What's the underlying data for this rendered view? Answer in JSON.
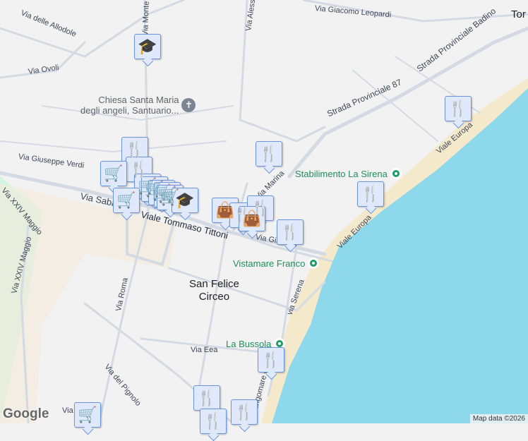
{
  "streets": [
    "Via delle Allodole",
    "Via Ovoli",
    "Via Giuseppe Verdi",
    "Via XXIV Maggio",
    "Via XXIV Maggio",
    "Via Sabaudia",
    "Viale Tommaso Tittoni",
    "Via Roma",
    "Via Eea",
    "Via del Pignolo",
    "Via Giacomo Leopardi",
    "Strada Provinciale 87",
    "Strada Provinciale Badino",
    "Viale Europa",
    "Viale Europa",
    "via Serena",
    "Lungomare Circe",
    "Via Monte Circeo",
    "Via Alessandro",
    "Via Gibraltar",
    "Via Marina",
    "Via"
  ],
  "town": {
    "line1": "San Felice",
    "line2": "Circeo"
  },
  "edge_town": "Tor",
  "church": {
    "line1": "Chiesa Santa Maria",
    "line2": "degli angeli, Santuario..."
  },
  "pois": [
    "Stabilimento La Sirena",
    "Vistamare Franco",
    "La Bussola"
  ],
  "markers": {
    "restaurant": "restaurant-icon",
    "cart": "shopping-cart-icon",
    "school": "school-icon",
    "bag": "shopping-bag-icon"
  },
  "colors": {
    "land": "#f3f2f3",
    "sea": "#8ed8ec",
    "beach": "#f5e9cc",
    "park": "#d4f5e3",
    "poi": "#1e8e5a"
  },
  "footer": {
    "logo": "Google",
    "attribution": "Map data ©2026"
  }
}
